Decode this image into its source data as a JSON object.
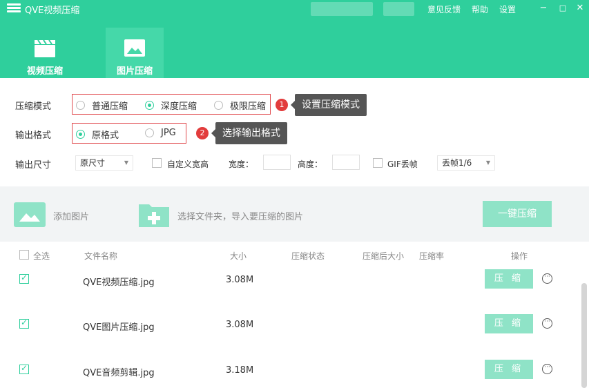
{
  "window": {
    "title": "QVE视频压缩",
    "menu": [
      "意见反馈",
      "帮助",
      "设置"
    ],
    "controls": [
      "−",
      "□",
      "✕"
    ]
  },
  "tabs": [
    {
      "label": "视频压缩",
      "active": false
    },
    {
      "label": "图片压缩",
      "active": true
    }
  ],
  "settings": {
    "mode_label": "压缩模式",
    "modes": [
      {
        "label": "普通压缩",
        "checked": false
      },
      {
        "label": "深度压缩",
        "checked": true
      },
      {
        "label": "极限压缩",
        "checked": false
      }
    ],
    "mode_badge": "1",
    "mode_tip": "设置压缩模式",
    "format_label": "输出格式",
    "formats": [
      {
        "label": "原格式",
        "checked": true
      },
      {
        "label": "JPG",
        "checked": false
      }
    ],
    "format_badge": "2",
    "format_tip": "选择输出格式",
    "size_label": "输出尺寸",
    "size_select": "原尺寸",
    "custom_size_label": "自定义宽高",
    "width_label": "宽度：",
    "height_label": "高度：",
    "gif_label": "GIF丢帧",
    "gif_select": "丢帧1/6"
  },
  "toolbar": {
    "add_image": "添加图片",
    "select_folder": "选择文件夹，导入要压缩的图片",
    "one_click": "一键压缩"
  },
  "list": {
    "headers": {
      "select_all": "全选",
      "name": "文件名称",
      "size": "大小",
      "status": "压缩状态",
      "after_size": "压缩后大小",
      "ratio": "压缩率",
      "action": "操作"
    },
    "rows": [
      {
        "name": "QVE视频压缩.jpg",
        "size": "3.08M",
        "action": "压 缩",
        "checked": true
      },
      {
        "name": "QVE图片压缩.jpg",
        "size": "3.08M",
        "action": "压 缩",
        "checked": true
      },
      {
        "name": "QVE音频剪辑.jpg",
        "size": "3.18M",
        "action": "压 缩",
        "checked": true
      }
    ]
  },
  "colors": {
    "brand": "#2fcf9c",
    "accent_light": "#8fe3c7",
    "badge": "#e23c3c",
    "highlight_border": "#e0484c"
  }
}
